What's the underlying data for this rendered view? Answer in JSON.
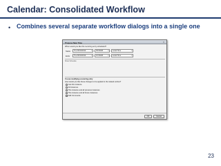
{
  "slide": {
    "title": "Calendar: Consolidated Workflow",
    "bullet": "Combines several separate workflow dialogs into a single one",
    "page_number": "23",
    "colors": {
      "title": "#1c2e55",
      "rule": "#1c3a6e",
      "bullet": "#1c3f7e"
    }
  },
  "dialog": {
    "title": "Propose New Time",
    "close_icon": "close-icon",
    "question": "When would you like this recurring entry scheduled?",
    "start": {
      "label": "Starts",
      "date": "Tue 09/11/2012",
      "time": "09:00AM",
      "zone": "Local Time"
    },
    "end": {
      "label": "Ends",
      "date": "Tue 09/11/2012",
      "time": "10:00AM",
      "zone": "Local Time"
    },
    "section_duration": "Show Schedule",
    "section_recurring": "You are modifying a recurring entry",
    "apply_question": "How would you like these changes to be applied to the related entries?",
    "options": [
      {
        "label": "Just this instance",
        "selected": true
      },
      {
        "label": "All instances",
        "selected": false
      },
      {
        "label": "This instance and all previous instances",
        "selected": false
      },
      {
        "label": "This instance and all future instances",
        "selected": false
      }
    ],
    "comments_label": "Add Comments",
    "ok_label": "OK",
    "cancel_label": "Cancel"
  }
}
